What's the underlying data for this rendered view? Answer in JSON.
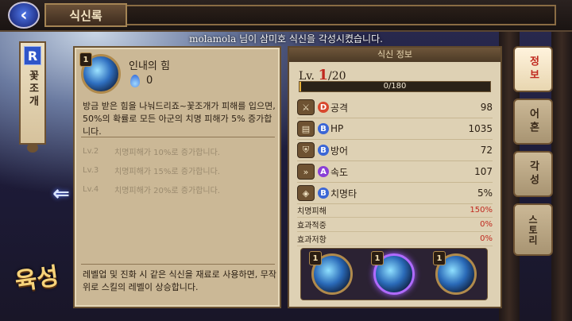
{
  "header": {
    "title": "식신록"
  },
  "notice": "molamola  님이 삼미호  식신을 각성시켰습니다.",
  "character": {
    "rank": "R",
    "name": "꽃조개"
  },
  "growth_label": "육성",
  "skill": {
    "level": "1",
    "name": "인내의 힘",
    "cost": "0",
    "description": "방금 받은 힘을 나눠드리죠~꽃조개가 피해를 입으면, 50%의 확률로 모든 아군의 치명 피해가 5% 증가합니다.",
    "upgrades": [
      {
        "lv": "Lv.2",
        "text": "치명피해가 10%로 증가합니다."
      },
      {
        "lv": "Lv.3",
        "text": "치명피해가 15%로 증가합니다."
      },
      {
        "lv": "Lv.4",
        "text": "치명피해가 20%로 증가합니다."
      }
    ],
    "footer": "레벨업 및 진화 시 같은 식신을 재료로 사용하면, 무작위로 스킬의 레벨이 상승합니다."
  },
  "info": {
    "header": "식신 정보",
    "level_prefix": "Lv.",
    "level_current": "1",
    "level_max": "/20",
    "xp_text": "0/180",
    "xp_fraction": 0.01,
    "stats": [
      {
        "icon": "sword-icon",
        "grade": "D",
        "grade_color": "#d8482e",
        "name": "공격",
        "value": "98"
      },
      {
        "icon": "scroll-icon",
        "grade": "B",
        "grade_color": "#3b66d6",
        "name": "HP",
        "value": "1035"
      },
      {
        "icon": "shield-icon",
        "grade": "B",
        "grade_color": "#3b66d6",
        "name": "방어",
        "value": "72"
      },
      {
        "icon": "boot-icon",
        "grade": "A",
        "grade_color": "#8a3fd6",
        "name": "속도",
        "value": "107"
      },
      {
        "icon": "crit-icon",
        "grade": "B",
        "grade_color": "#3b66d6",
        "name": "치명타",
        "value": "5%"
      }
    ],
    "sub_stats": [
      {
        "name": "치명피해",
        "value": "150%"
      },
      {
        "name": "효과적중",
        "value": "0%"
      },
      {
        "name": "효과저항",
        "value": "0%"
      }
    ],
    "skill_slots": [
      {
        "level": "1"
      },
      {
        "level": "1"
      },
      {
        "level": "1"
      }
    ]
  },
  "tabs": [
    {
      "label": "정보"
    },
    {
      "label": "어혼"
    },
    {
      "label": "각성"
    },
    {
      "label": "스토리"
    }
  ]
}
